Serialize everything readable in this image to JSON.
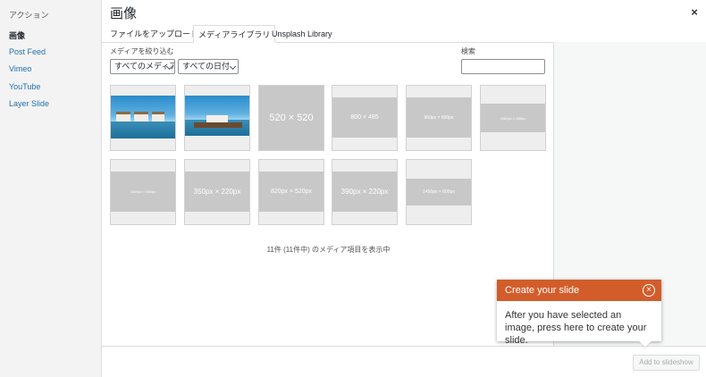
{
  "sidebar": {
    "heading": "アクション",
    "items": [
      {
        "label": "画像"
      },
      {
        "label": "Post Feed"
      },
      {
        "label": "Vimeo"
      },
      {
        "label": "YouTube"
      },
      {
        "label": "Layer Slide"
      }
    ]
  },
  "header": {
    "title": "画像",
    "close_icon": "×"
  },
  "tabs": [
    {
      "label": "ファイルをアップロード"
    },
    {
      "label": "メディアライブラリ"
    },
    {
      "label": "Unsplash Library"
    }
  ],
  "filters": {
    "label": "メディアを絞り込む",
    "type_select": "すべてのメディア",
    "date_select": "すべての日付"
  },
  "search": {
    "label": "検索",
    "value": ""
  },
  "attachments": [
    {
      "kind": "photo"
    },
    {
      "kind": "photo"
    },
    {
      "kind": "placeholder",
      "text": "520 × 520"
    },
    {
      "kind": "placeholder",
      "text": "800 × 485"
    },
    {
      "kind": "placeholder",
      "text": "960px × 600px"
    },
    {
      "kind": "placeholder",
      "text": "1060px × 580px"
    },
    {
      "kind": "placeholder",
      "text": "1400px × 800px"
    },
    {
      "kind": "placeholder",
      "text": "350px × 220px"
    },
    {
      "kind": "placeholder",
      "text": "820px × 520px"
    },
    {
      "kind": "placeholder",
      "text": "390px × 220px"
    },
    {
      "kind": "placeholder",
      "text": "1450px × 600px"
    }
  ],
  "count_text": "11件 (11件中) のメディア項目を表示中",
  "tooltip": {
    "title": "Create your slide",
    "body": "After you have selected an image, press here to create your slide.",
    "close_icon": "×",
    "header_color": "#d25d2b"
  },
  "footer": {
    "add_button": "Add to slideshow"
  }
}
